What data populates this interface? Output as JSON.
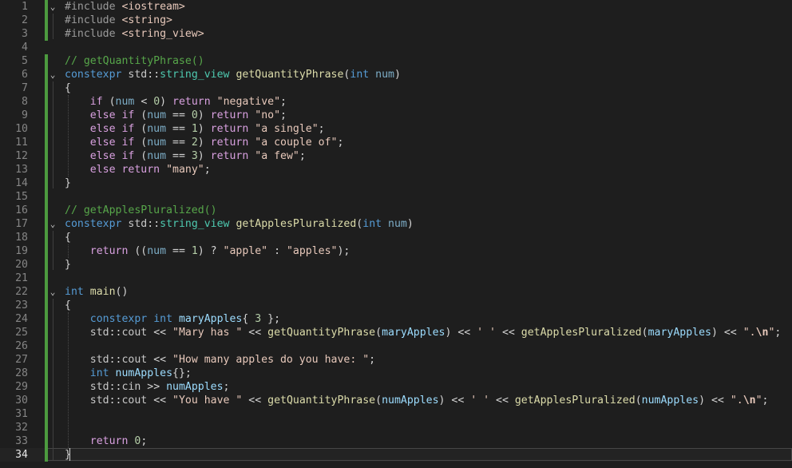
{
  "editor": {
    "accent_colors": {
      "background": "#1e1e1e",
      "keyword": "#569cd6",
      "control": "#d8a0df",
      "string": "#e8c9bb",
      "comment": "#57a64a",
      "type": "#4ec9b0",
      "function": "#dcdcaa",
      "variable": "#9cdcfe",
      "number": "#b5cea8",
      "change_bar": "#4c9a3f"
    },
    "current_line": 34,
    "lines": [
      [
        {
          "t": "pp",
          "v": "#include "
        },
        {
          "t": "inc",
          "v": "<iostream>"
        }
      ],
      [
        {
          "t": "pp",
          "v": "#include "
        },
        {
          "t": "inc",
          "v": "<string>"
        }
      ],
      [
        {
          "t": "pp",
          "v": "#include "
        },
        {
          "t": "inc",
          "v": "<string_view>"
        }
      ],
      [],
      [
        {
          "t": "cm",
          "v": "// getQuantityPhrase()"
        }
      ],
      [
        {
          "t": "kw",
          "v": "constexpr"
        },
        {
          "t": "p",
          "v": " "
        },
        {
          "t": "ns",
          "v": "std"
        },
        {
          "t": "p",
          "v": "::"
        },
        {
          "t": "ty",
          "v": "string_view"
        },
        {
          "t": "p",
          "v": " "
        },
        {
          "t": "fn",
          "v": "getQuantityPhrase"
        },
        {
          "t": "p",
          "v": "("
        },
        {
          "t": "kw",
          "v": "int"
        },
        {
          "t": "p",
          "v": " "
        },
        {
          "t": "par",
          "v": "num"
        },
        {
          "t": "p",
          "v": ")"
        }
      ],
      [
        {
          "t": "p",
          "v": "{"
        }
      ],
      [
        {
          "t": "p",
          "v": "    "
        },
        {
          "t": "ctl",
          "v": "if"
        },
        {
          "t": "p",
          "v": " ("
        },
        {
          "t": "par",
          "v": "num"
        },
        {
          "t": "p",
          "v": " < "
        },
        {
          "t": "num",
          "v": "0"
        },
        {
          "t": "p",
          "v": ") "
        },
        {
          "t": "ctl",
          "v": "return"
        },
        {
          "t": "p",
          "v": " "
        },
        {
          "t": "str",
          "v": "\"negative\""
        },
        {
          "t": "p",
          "v": ";"
        }
      ],
      [
        {
          "t": "p",
          "v": "    "
        },
        {
          "t": "ctl",
          "v": "else if"
        },
        {
          "t": "p",
          "v": " ("
        },
        {
          "t": "par",
          "v": "num"
        },
        {
          "t": "p",
          "v": " == "
        },
        {
          "t": "num",
          "v": "0"
        },
        {
          "t": "p",
          "v": ") "
        },
        {
          "t": "ctl",
          "v": "return"
        },
        {
          "t": "p",
          "v": " "
        },
        {
          "t": "str",
          "v": "\"no\""
        },
        {
          "t": "p",
          "v": ";"
        }
      ],
      [
        {
          "t": "p",
          "v": "    "
        },
        {
          "t": "ctl",
          "v": "else if"
        },
        {
          "t": "p",
          "v": " ("
        },
        {
          "t": "par",
          "v": "num"
        },
        {
          "t": "p",
          "v": " == "
        },
        {
          "t": "num",
          "v": "1"
        },
        {
          "t": "p",
          "v": ") "
        },
        {
          "t": "ctl",
          "v": "return"
        },
        {
          "t": "p",
          "v": " "
        },
        {
          "t": "str",
          "v": "\"a single\""
        },
        {
          "t": "p",
          "v": ";"
        }
      ],
      [
        {
          "t": "p",
          "v": "    "
        },
        {
          "t": "ctl",
          "v": "else if"
        },
        {
          "t": "p",
          "v": " ("
        },
        {
          "t": "par",
          "v": "num"
        },
        {
          "t": "p",
          "v": " == "
        },
        {
          "t": "num",
          "v": "2"
        },
        {
          "t": "p",
          "v": ") "
        },
        {
          "t": "ctl",
          "v": "return"
        },
        {
          "t": "p",
          "v": " "
        },
        {
          "t": "str",
          "v": "\"a couple of\""
        },
        {
          "t": "p",
          "v": ";"
        }
      ],
      [
        {
          "t": "p",
          "v": "    "
        },
        {
          "t": "ctl",
          "v": "else if"
        },
        {
          "t": "p",
          "v": " ("
        },
        {
          "t": "par",
          "v": "num"
        },
        {
          "t": "p",
          "v": " == "
        },
        {
          "t": "num",
          "v": "3"
        },
        {
          "t": "p",
          "v": ") "
        },
        {
          "t": "ctl",
          "v": "return"
        },
        {
          "t": "p",
          "v": " "
        },
        {
          "t": "str",
          "v": "\"a few\""
        },
        {
          "t": "p",
          "v": ";"
        }
      ],
      [
        {
          "t": "p",
          "v": "    "
        },
        {
          "t": "ctl",
          "v": "else return"
        },
        {
          "t": "p",
          "v": " "
        },
        {
          "t": "str",
          "v": "\"many\""
        },
        {
          "t": "p",
          "v": ";"
        }
      ],
      [
        {
          "t": "p",
          "v": "}"
        }
      ],
      [],
      [
        {
          "t": "cm",
          "v": "// getApplesPluralized()"
        }
      ],
      [
        {
          "t": "kw",
          "v": "constexpr"
        },
        {
          "t": "p",
          "v": " "
        },
        {
          "t": "ns",
          "v": "std"
        },
        {
          "t": "p",
          "v": "::"
        },
        {
          "t": "ty",
          "v": "string_view"
        },
        {
          "t": "p",
          "v": " "
        },
        {
          "t": "fn",
          "v": "getApplesPluralized"
        },
        {
          "t": "p",
          "v": "("
        },
        {
          "t": "kw",
          "v": "int"
        },
        {
          "t": "p",
          "v": " "
        },
        {
          "t": "par",
          "v": "num"
        },
        {
          "t": "p",
          "v": ")"
        }
      ],
      [
        {
          "t": "p",
          "v": "{"
        }
      ],
      [
        {
          "t": "p",
          "v": "    "
        },
        {
          "t": "ctl",
          "v": "return"
        },
        {
          "t": "p",
          "v": " (("
        },
        {
          "t": "par",
          "v": "num"
        },
        {
          "t": "p",
          "v": " == "
        },
        {
          "t": "num",
          "v": "1"
        },
        {
          "t": "p",
          "v": ") ? "
        },
        {
          "t": "str",
          "v": "\"apple\""
        },
        {
          "t": "p",
          "v": " : "
        },
        {
          "t": "str",
          "v": "\"apples\""
        },
        {
          "t": "p",
          "v": ");"
        }
      ],
      [
        {
          "t": "p",
          "v": "}"
        }
      ],
      [],
      [
        {
          "t": "kw",
          "v": "int"
        },
        {
          "t": "p",
          "v": " "
        },
        {
          "t": "fn",
          "v": "main"
        },
        {
          "t": "p",
          "v": "()"
        }
      ],
      [
        {
          "t": "p",
          "v": "{"
        }
      ],
      [
        {
          "t": "p",
          "v": "    "
        },
        {
          "t": "kw",
          "v": "constexpr"
        },
        {
          "t": "p",
          "v": " "
        },
        {
          "t": "kw",
          "v": "int"
        },
        {
          "t": "p",
          "v": " "
        },
        {
          "t": "var",
          "v": "maryApples"
        },
        {
          "t": "p",
          "v": "{ "
        },
        {
          "t": "num",
          "v": "3"
        },
        {
          "t": "p",
          "v": " };"
        }
      ],
      [
        {
          "t": "p",
          "v": "    "
        },
        {
          "t": "ns",
          "v": "std"
        },
        {
          "t": "p",
          "v": "::"
        },
        {
          "t": "ns",
          "v": "cout"
        },
        {
          "t": "p",
          "v": " << "
        },
        {
          "t": "str",
          "v": "\"Mary has \""
        },
        {
          "t": "p",
          "v": " << "
        },
        {
          "t": "fn",
          "v": "getQuantityPhrase"
        },
        {
          "t": "p",
          "v": "("
        },
        {
          "t": "var",
          "v": "maryApples"
        },
        {
          "t": "p",
          "v": ") << "
        },
        {
          "t": "str",
          "v": "' '"
        },
        {
          "t": "p",
          "v": " << "
        },
        {
          "t": "fn",
          "v": "getApplesPluralized"
        },
        {
          "t": "p",
          "v": "("
        },
        {
          "t": "var",
          "v": "maryApples"
        },
        {
          "t": "p",
          "v": ") << "
        },
        {
          "t": "str",
          "v": "\"."
        },
        {
          "t": "esc",
          "v": "\\n"
        },
        {
          "t": "str",
          "v": "\""
        },
        {
          "t": "p",
          "v": ";"
        }
      ],
      [],
      [
        {
          "t": "p",
          "v": "    "
        },
        {
          "t": "ns",
          "v": "std"
        },
        {
          "t": "p",
          "v": "::"
        },
        {
          "t": "ns",
          "v": "cout"
        },
        {
          "t": "p",
          "v": " << "
        },
        {
          "t": "str",
          "v": "\"How many apples do you have: \""
        },
        {
          "t": "p",
          "v": ";"
        }
      ],
      [
        {
          "t": "p",
          "v": "    "
        },
        {
          "t": "kw",
          "v": "int"
        },
        {
          "t": "p",
          "v": " "
        },
        {
          "t": "var",
          "v": "numApples"
        },
        {
          "t": "p",
          "v": "{};"
        }
      ],
      [
        {
          "t": "p",
          "v": "    "
        },
        {
          "t": "ns",
          "v": "std"
        },
        {
          "t": "p",
          "v": "::"
        },
        {
          "t": "ns",
          "v": "cin"
        },
        {
          "t": "p",
          "v": " >> "
        },
        {
          "t": "var",
          "v": "numApples"
        },
        {
          "t": "p",
          "v": ";"
        }
      ],
      [
        {
          "t": "p",
          "v": "    "
        },
        {
          "t": "ns",
          "v": "std"
        },
        {
          "t": "p",
          "v": "::"
        },
        {
          "t": "ns",
          "v": "cout"
        },
        {
          "t": "p",
          "v": " << "
        },
        {
          "t": "str",
          "v": "\"You have \""
        },
        {
          "t": "p",
          "v": " << "
        },
        {
          "t": "fn",
          "v": "getQuantityPhrase"
        },
        {
          "t": "p",
          "v": "("
        },
        {
          "t": "var",
          "v": "numApples"
        },
        {
          "t": "p",
          "v": ") << "
        },
        {
          "t": "str",
          "v": "' '"
        },
        {
          "t": "p",
          "v": " << "
        },
        {
          "t": "fn",
          "v": "getApplesPluralized"
        },
        {
          "t": "p",
          "v": "("
        },
        {
          "t": "var",
          "v": "numApples"
        },
        {
          "t": "p",
          "v": ") << "
        },
        {
          "t": "str",
          "v": "\"."
        },
        {
          "t": "esc",
          "v": "\\n"
        },
        {
          "t": "str",
          "v": "\""
        },
        {
          "t": "p",
          "v": ";"
        }
      ],
      [],
      [],
      [
        {
          "t": "p",
          "v": "    "
        },
        {
          "t": "ctl",
          "v": "return"
        },
        {
          "t": "p",
          "v": " "
        },
        {
          "t": "num",
          "v": "0"
        },
        {
          "t": "p",
          "v": ";"
        }
      ],
      [
        {
          "t": "p",
          "v": "}"
        }
      ]
    ],
    "fold_marker": "⌄"
  }
}
